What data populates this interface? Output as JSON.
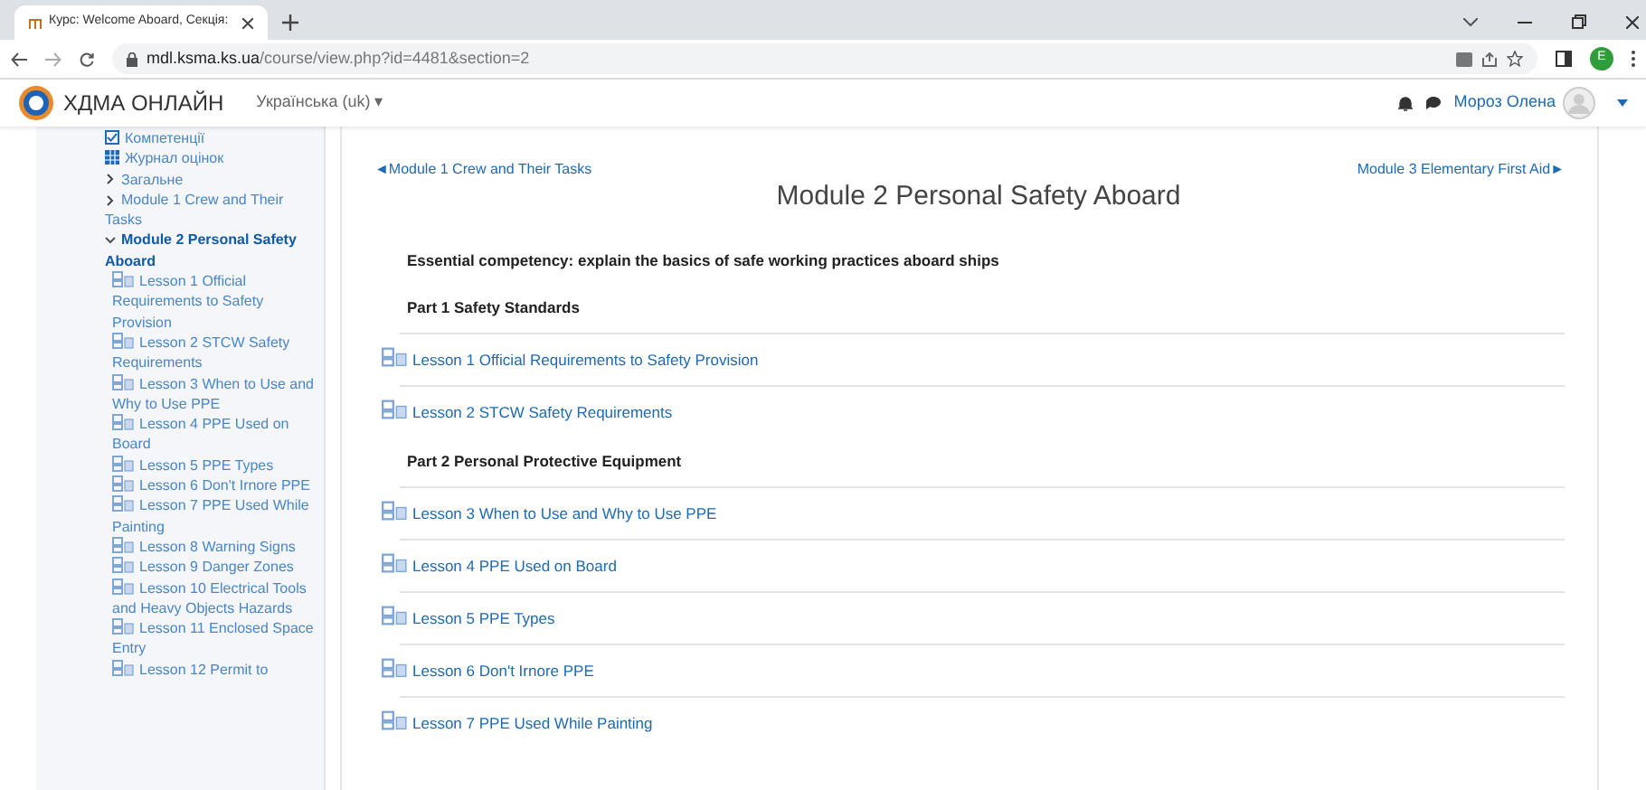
{
  "browser": {
    "tab_title": "Курс: Welcome Aboard, Секція: ",
    "url_host": "mdl.ksma.ks.ua",
    "url_path": "/course/view.php?id=4481&section=2",
    "profile_initial": "E"
  },
  "header": {
    "site_name": "ХДМА ОНЛАЙН",
    "language": "Українська (uk) ▾",
    "user_name": "Мороз Олена"
  },
  "sidebar": {
    "items": [
      {
        "kind": "competency",
        "label": "Компетенції",
        "selected": false
      },
      {
        "kind": "grades",
        "label": "Журнал оцінок",
        "selected": false
      },
      {
        "kind": "section",
        "label": "Загальне",
        "expanded": false,
        "selected": false
      },
      {
        "kind": "section",
        "label": "Module 1 Crew and Their Tasks",
        "expanded": false,
        "selected": false
      },
      {
        "kind": "section",
        "label": "Module 2 Personal Safety Aboard",
        "expanded": true,
        "selected": true,
        "children": [
          {
            "kind": "lesson",
            "label": "Lesson 1 Official Requirements to Safety Provision"
          },
          {
            "kind": "lesson",
            "label": "Lesson 2 STCW Safety Requirements"
          },
          {
            "kind": "lesson",
            "label": "Lesson 3 When to Use and Why to Use PPE"
          },
          {
            "kind": "lesson",
            "label": "Lesson 4 PPE Used on Board"
          },
          {
            "kind": "lesson",
            "label": "Lesson 5 PPE Types"
          },
          {
            "kind": "lesson",
            "label": "Lesson 6 Don't Irnore PPE"
          },
          {
            "kind": "lesson",
            "label": "Lesson 7 PPE Used While Painting"
          },
          {
            "kind": "lesson",
            "label": "Lesson 8 Warning Signs"
          },
          {
            "kind": "lesson",
            "label": "Lesson 9 Danger Zones"
          },
          {
            "kind": "lesson",
            "label": "Lesson 10 Electrical Tools and Heavy Objects Hazards"
          },
          {
            "kind": "lesson",
            "label": "Lesson 11 Enclosed Space Entry"
          },
          {
            "kind": "lesson",
            "label": "Lesson 12 Permit to"
          }
        ]
      }
    ]
  },
  "content": {
    "prev_link": "◄Module 1 Crew and Their Tasks",
    "next_link": "Module 3 Elementary First Aid►",
    "title": "Module 2 Personal Safety Aboard",
    "items": [
      {
        "kind": "heading",
        "text": "Essential competency: explain the basics of safe working practices aboard ships"
      },
      {
        "kind": "heading",
        "text": "Part 1 Safety Standards"
      },
      {
        "kind": "lesson",
        "text": "Lesson 1 Official Requirements to Safety Provision"
      },
      {
        "kind": "lesson",
        "text": "Lesson 2 STCW Safety Requirements"
      },
      {
        "kind": "heading",
        "text": "Part 2 Personal Protective Equipment"
      },
      {
        "kind": "lesson",
        "text": "Lesson 3 When to Use and Why to Use PPE"
      },
      {
        "kind": "lesson",
        "text": "Lesson 4 PPE Used on Board"
      },
      {
        "kind": "lesson",
        "text": "Lesson 5 PPE Types"
      },
      {
        "kind": "lesson",
        "text": "Lesson 6 Don't Irnore PPE"
      },
      {
        "kind": "lesson",
        "text": "Lesson 7 PPE Used While Painting"
      }
    ]
  }
}
